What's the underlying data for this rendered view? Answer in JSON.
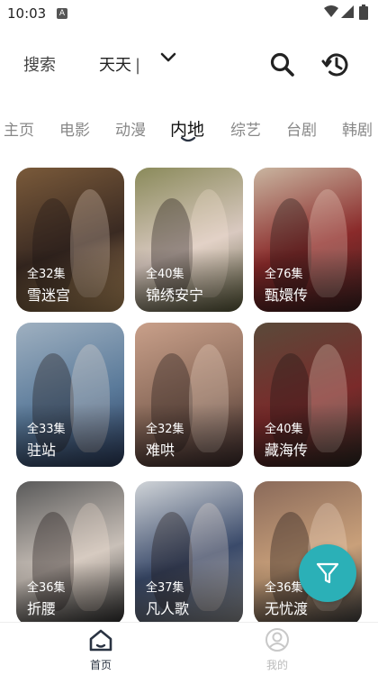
{
  "status_bar": {
    "time": "10:03",
    "notification_icon": "A"
  },
  "search": {
    "label": "搜索",
    "keyword": "天天"
  },
  "tabs": [
    {
      "label": "主页",
      "active": false
    },
    {
      "label": "电影",
      "active": false
    },
    {
      "label": "动漫",
      "active": false
    },
    {
      "label": "内地",
      "active": true
    },
    {
      "label": "综艺",
      "active": false
    },
    {
      "label": "台剧",
      "active": false
    },
    {
      "label": "韩剧",
      "active": false
    }
  ],
  "shows": [
    {
      "title": "雪迷宫",
      "episodes": "全32集",
      "colors": [
        "#7a5a3a",
        "#3a2a22",
        "#b08a5a"
      ]
    },
    {
      "title": "锦绣安宁",
      "episodes": "全40集",
      "colors": [
        "#8a8a5a",
        "#d9c9c0",
        "#5a5a3a"
      ]
    },
    {
      "title": "甄嬛传",
      "episodes": "全76集",
      "colors": [
        "#c9b5a0",
        "#8a2a2a",
        "#3a2020"
      ]
    },
    {
      "title": "驻站",
      "episodes": "全33集",
      "colors": [
        "#9fb0c0",
        "#5a7a9a",
        "#2a3a5a"
      ]
    },
    {
      "title": "难哄",
      "episodes": "全32集",
      "colors": [
        "#c9a08a",
        "#8a6a5a",
        "#3a2a2a"
      ]
    },
    {
      "title": "藏海传",
      "episodes": "全40集",
      "colors": [
        "#5a4a3a",
        "#7a2a2a",
        "#2a2520"
      ]
    },
    {
      "title": "折腰",
      "episodes": "全36集",
      "colors": [
        "#5a5a5a",
        "#c9c0b8",
        "#2a2a2a"
      ]
    },
    {
      "title": "凡人歌",
      "episodes": "全37集",
      "colors": [
        "#d0d4d8",
        "#3a4a6a",
        "#8a8a8a"
      ]
    },
    {
      "title": "无忧渡",
      "episodes": "全36集",
      "colors": [
        "#8a6a5a",
        "#c9a07a",
        "#3a3a3a"
      ]
    }
  ],
  "bottom_nav": [
    {
      "label": "首页",
      "icon": "home-icon",
      "active": true
    },
    {
      "label": "我的",
      "icon": "profile-icon",
      "active": false
    }
  ],
  "accent_color": "#2bb0b7"
}
